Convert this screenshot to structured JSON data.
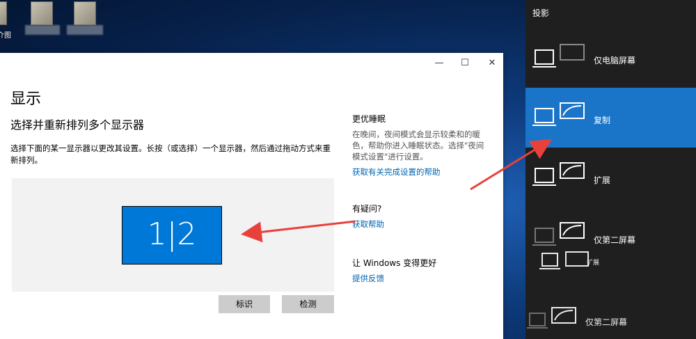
{
  "desktop": {
    "icon_label": "介图"
  },
  "window": {
    "minimize_icon": "—",
    "maximize_icon": "☐",
    "close_icon": "✕",
    "title": "显示",
    "subtitle": "选择并重新排列多个显示器",
    "description": "选择下面的某一显示器以更改其设置。长按（或选择）一个显示器，然后通过拖动方式来重新排列。",
    "monitor_label": "1|2",
    "identify_button": "标识",
    "detect_button": "检测",
    "sleep": {
      "heading": "更优睡眠",
      "text": "在晚间，夜间模式会显示较柔和的暖色，帮助你进入睡眠状态。选择\"夜间模式设置\"进行设置。",
      "link": "获取有关完成设置的帮助"
    },
    "question": {
      "heading": "有疑问?",
      "link": "获取帮助"
    },
    "feedback": {
      "heading": "让 Windows 变得更好",
      "link": "提供反馈"
    }
  },
  "project_panel": {
    "title": "投影",
    "options": [
      {
        "label": "仅电脑屏幕",
        "icon": "pc-screen-only-icon",
        "selected": false
      },
      {
        "label": "复制",
        "icon": "duplicate-icon",
        "selected": true
      },
      {
        "label": "扩展",
        "icon": "extend-icon",
        "selected": false
      },
      {
        "label": "仅第二屏幕",
        "icon": "second-screen-only-icon",
        "selected": false
      }
    ],
    "ghost_options": [
      {
        "label": "扩展"
      },
      {
        "label": "仅第二屏幕"
      }
    ]
  },
  "colors": {
    "accent": "#0078d7",
    "panel_selected": "#1a75c9",
    "panel_bg": "#1f1f1f",
    "link": "#0063b1",
    "annotation_arrow": "#e8413c"
  }
}
